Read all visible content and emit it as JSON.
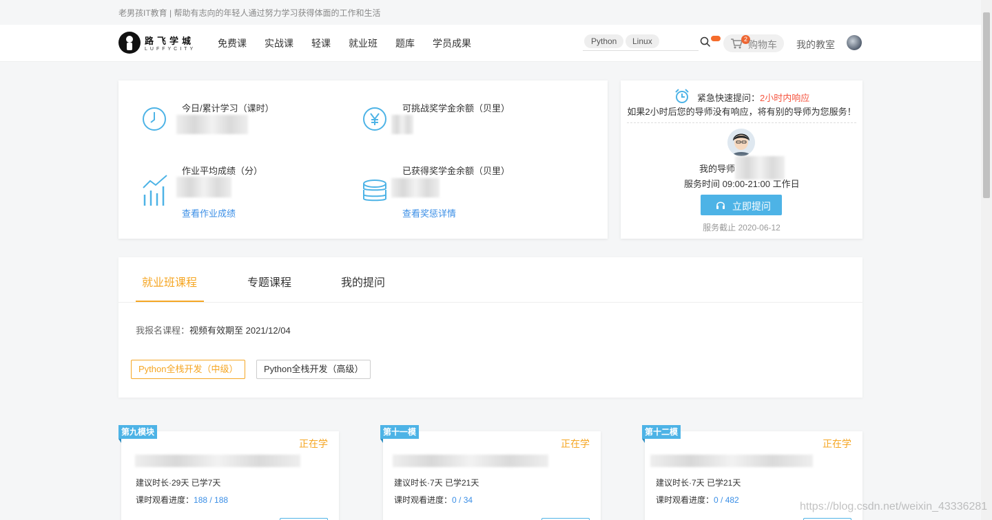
{
  "banner": {
    "text": "老男孩IT教育 | 帮助有志向的年轻人通过努力学习获得体面的工作和生活"
  },
  "header": {
    "logo_cn": "路飞学城",
    "logo_en": "LUFFYCITY",
    "nav": [
      "免费课",
      "实战课",
      "轻课",
      "就业班",
      "题库",
      "学员成果"
    ],
    "search_tags": [
      "Python",
      "Linux"
    ],
    "search_icon": "search-icon",
    "cart_badge": "2",
    "cart_label": "购物车",
    "classroom": "我的教室"
  },
  "stats": {
    "today_label": "今日/累计学习（课时）",
    "challenge_label": "可挑战奖学金余额（贝里）",
    "avg_score_label": "作业平均成绩（分）",
    "earned_label": "已获得奖学金余额（贝里）",
    "view_scores_link": "查看作业成绩",
    "view_scholarship_link": "查看奖惩详情"
  },
  "tutor": {
    "urgent_label": "紧急快速提问：",
    "urgent_highlight": "2小时内响应",
    "urgent_sub": "如果2小时后您的导师没有响应，将有别的导师为您服务！",
    "tutor_label": "我的导师",
    "service_time": "服务时间 09:00-21:00 工作日",
    "ask_button": "立即提问",
    "deadline": "服务截止 2020-06-12"
  },
  "tabs": {
    "items": [
      "就业班课程",
      "专题课程",
      "我的提问"
    ],
    "enroll_label": "我报名课程：",
    "enroll_value": "视频有效期至 2021/12/04",
    "courses": [
      "Python全栈开发（中级）",
      "Python全栈开发（高级）"
    ]
  },
  "cards": [
    {
      "tag": "第九模块",
      "status": "正在学",
      "meta": "建议时长·29天  已学7天",
      "progress_label": "课时观看进度：",
      "progress": "188 / 188"
    },
    {
      "tag": "第十一模",
      "status": "正在学",
      "meta": "建议时长·7天  已学21天",
      "progress_label": "课时观看进度：",
      "progress": "0 / 34"
    },
    {
      "tag": "第十二模",
      "status": "正在学",
      "meta": "建议时长·7天  已学21天",
      "progress_label": "课时观看进度：",
      "progress": "0 / 482"
    }
  ],
  "watermark": "https://blog.csdn.net/weixin_43336281"
}
